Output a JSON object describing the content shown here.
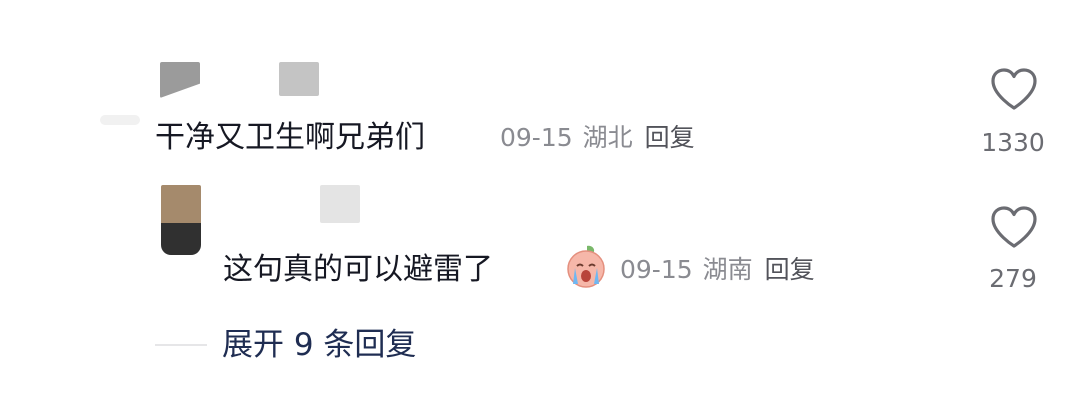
{
  "comments": [
    {
      "text": "干净又卫生啊兄弟们",
      "date": "09-15",
      "location": "湖北",
      "reply_label": "回复",
      "like_count": "1330",
      "like_icon": "heart-outline-icon"
    },
    {
      "text": "这句真的可以避雷了",
      "emoji": "crying-face-sticker",
      "date": "09-15",
      "location": "湖南",
      "reply_label": "回复",
      "like_count": "279",
      "like_icon": "heart-outline-icon"
    }
  ],
  "expand_replies_label": "展开 9 条回复",
  "colors": {
    "text": "#161823",
    "meta": "#8a8b91",
    "expand": "#1f2d52",
    "icon": "#6b6c72"
  }
}
